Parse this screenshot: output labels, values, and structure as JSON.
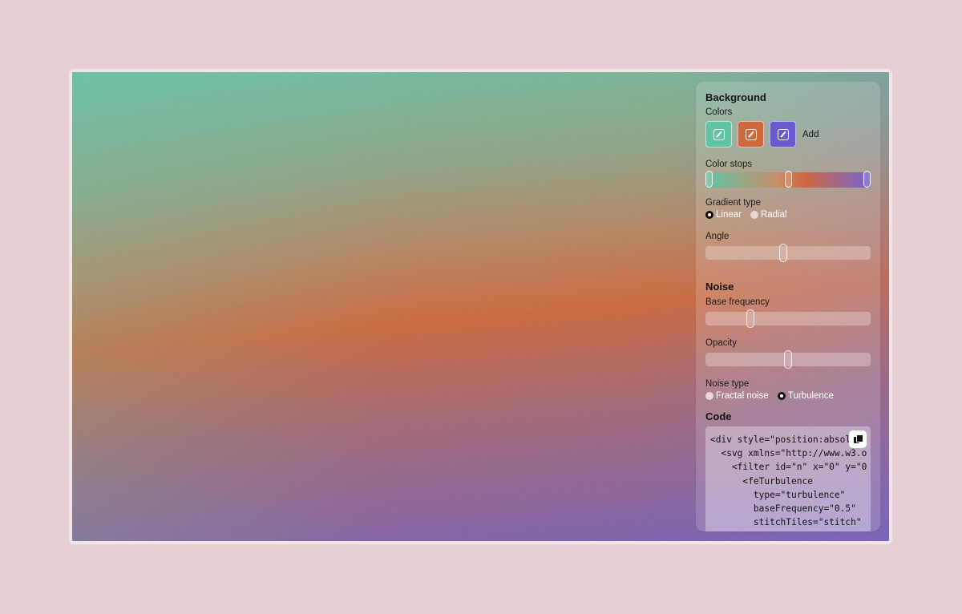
{
  "background": {
    "title": "Background",
    "colors_label": "Colors",
    "colors": [
      {
        "hex": "#62c4a4",
        "icon": "pencil-icon"
      },
      {
        "hex": "#cf6a3e",
        "icon": "pencil-icon"
      },
      {
        "hex": "#6a5ad0",
        "icon": "pencil-icon"
      }
    ],
    "add_label": "Add",
    "stops_label": "Color stops",
    "stops": [
      0,
      0.5,
      1
    ],
    "gradient_type_label": "Gradient type",
    "gradient_types": [
      {
        "label": "Linear",
        "selected": true
      },
      {
        "label": "Radial",
        "selected": false
      }
    ],
    "angle_label": "Angle",
    "angle_value": 0.47
  },
  "noise": {
    "title": "Noise",
    "base_frequency_label": "Base frequency",
    "base_frequency_value": 0.26,
    "opacity_label": "Opacity",
    "opacity_value": 0.5,
    "noise_type_label": "Noise type",
    "noise_types": [
      {
        "label": "Fractal noise",
        "selected": false
      },
      {
        "label": "Turbulence",
        "selected": true
      }
    ]
  },
  "code": {
    "title": "Code",
    "copy_icon": "copy-icon",
    "lines": [
      "<div style=\"position:absolute",
      "  <svg xmlns=\"http://www.w3.o",
      "    <filter id=\"n\" x=\"0\" y=\"0",
      "      <feTurbulence",
      "        type=\"turbulence\"",
      "        baseFrequency=\"0.5\"",
      "        stitchTiles=\"stitch\"",
      "      />"
    ]
  }
}
